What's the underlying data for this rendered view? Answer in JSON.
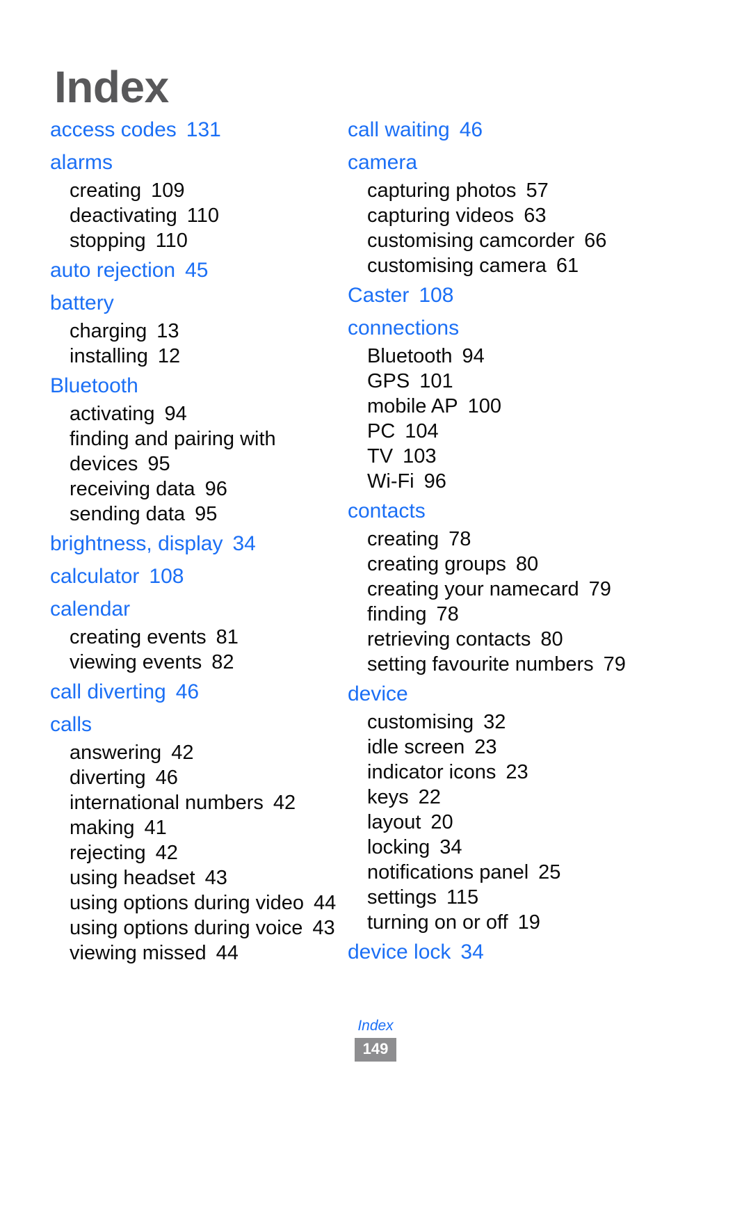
{
  "document": {
    "title": "Index",
    "footer_label": "Index",
    "page_number": "149"
  },
  "colors": {
    "entry_blue": "#1b6ff5",
    "title_gray": "#58585a",
    "subentry_black": "#0a0a0a",
    "page_box_gray": "#8e8e90"
  },
  "columns": [
    {
      "name": "left-column",
      "entries": [
        {
          "term": "access codes",
          "page": "131",
          "subs": []
        },
        {
          "term": "alarms",
          "page": "",
          "subs": [
            {
              "term": "creating",
              "page": "109"
            },
            {
              "term": "deactivating",
              "page": "110"
            },
            {
              "term": "stopping",
              "page": "110"
            }
          ]
        },
        {
          "term": "auto rejection",
          "page": "45",
          "subs": []
        },
        {
          "term": "battery",
          "page": "",
          "subs": [
            {
              "term": "charging",
              "page": "13"
            },
            {
              "term": "installing",
              "page": "12"
            }
          ]
        },
        {
          "term": "Bluetooth",
          "page": "",
          "subs": [
            {
              "term": "activating",
              "page": "94"
            },
            {
              "term": "finding and pairing with devices",
              "page": "95"
            },
            {
              "term": "receiving data",
              "page": "96"
            },
            {
              "term": "sending data",
              "page": "95"
            }
          ]
        },
        {
          "term": "brightness, display",
          "page": "34",
          "subs": []
        },
        {
          "term": "calculator",
          "page": "108",
          "subs": []
        },
        {
          "term": "calendar",
          "page": "",
          "subs": [
            {
              "term": "creating events",
              "page": "81"
            },
            {
              "term": "viewing events",
              "page": "82"
            }
          ]
        },
        {
          "term": "call diverting",
          "page": "46",
          "subs": []
        },
        {
          "term": "calls",
          "page": "",
          "subs": [
            {
              "term": "answering",
              "page": "42"
            },
            {
              "term": "diverting",
              "page": "46"
            },
            {
              "term": "international numbers",
              "page": "42"
            },
            {
              "term": "making",
              "page": "41"
            },
            {
              "term": "rejecting",
              "page": "42"
            },
            {
              "term": "using headset",
              "page": "43"
            },
            {
              "term": "using options during video",
              "page": "44"
            },
            {
              "term": "using options during voice",
              "page": "43"
            },
            {
              "term": "viewing missed",
              "page": "44"
            }
          ]
        }
      ]
    },
    {
      "name": "right-column",
      "entries": [
        {
          "term": "call waiting",
          "page": "46",
          "subs": []
        },
        {
          "term": "camera",
          "page": "",
          "subs": [
            {
              "term": "capturing photos",
              "page": "57"
            },
            {
              "term": "capturing videos",
              "page": "63"
            },
            {
              "term": "customising camcorder",
              "page": "66"
            },
            {
              "term": "customising camera",
              "page": "61"
            }
          ]
        },
        {
          "term": "Caster",
          "page": "108",
          "subs": []
        },
        {
          "term": "connections",
          "page": "",
          "subs": [
            {
              "term": "Bluetooth",
              "page": "94"
            },
            {
              "term": "GPS",
              "page": "101"
            },
            {
              "term": "mobile AP",
              "page": "100"
            },
            {
              "term": "PC",
              "page": "104"
            },
            {
              "term": "TV",
              "page": "103"
            },
            {
              "term": "Wi-Fi",
              "page": "96"
            }
          ]
        },
        {
          "term": "contacts",
          "page": "",
          "subs": [
            {
              "term": "creating",
              "page": "78"
            },
            {
              "term": "creating groups",
              "page": "80"
            },
            {
              "term": "creating your namecard",
              "page": "79"
            },
            {
              "term": "finding",
              "page": "78"
            },
            {
              "term": "retrieving contacts",
              "page": "80"
            },
            {
              "term": "setting favourite numbers",
              "page": "79"
            }
          ]
        },
        {
          "term": "device",
          "page": "",
          "subs": [
            {
              "term": "customising",
              "page": "32"
            },
            {
              "term": "idle screen",
              "page": "23"
            },
            {
              "term": "indicator icons",
              "page": "23"
            },
            {
              "term": "keys",
              "page": "22"
            },
            {
              "term": "layout",
              "page": "20"
            },
            {
              "term": "locking",
              "page": "34"
            },
            {
              "term": "notifications panel",
              "page": "25"
            },
            {
              "term": "settings",
              "page": "115"
            },
            {
              "term": "turning on or off",
              "page": "19"
            }
          ]
        },
        {
          "term": "device lock",
          "page": "34",
          "subs": []
        }
      ]
    }
  ]
}
